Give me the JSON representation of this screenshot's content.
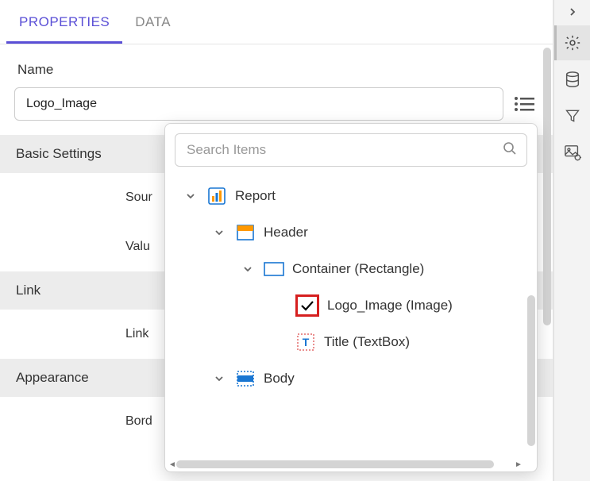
{
  "tabs": {
    "properties": "PROPERTIES",
    "data": "DATA"
  },
  "name": {
    "label": "Name",
    "value": "Logo_Image"
  },
  "sections": {
    "basic": "Basic Settings",
    "link": "Link",
    "appearance": "Appearance"
  },
  "props": {
    "source": "Sour",
    "value": "Valu",
    "linkto": "Link",
    "border": "Bord"
  },
  "search": {
    "placeholder": "Search Items"
  },
  "tree": {
    "report": "Report",
    "header": "Header",
    "container": "Container (Rectangle)",
    "logo": "Logo_Image (Image)",
    "title": "Title (TextBox)",
    "body": "Body"
  }
}
